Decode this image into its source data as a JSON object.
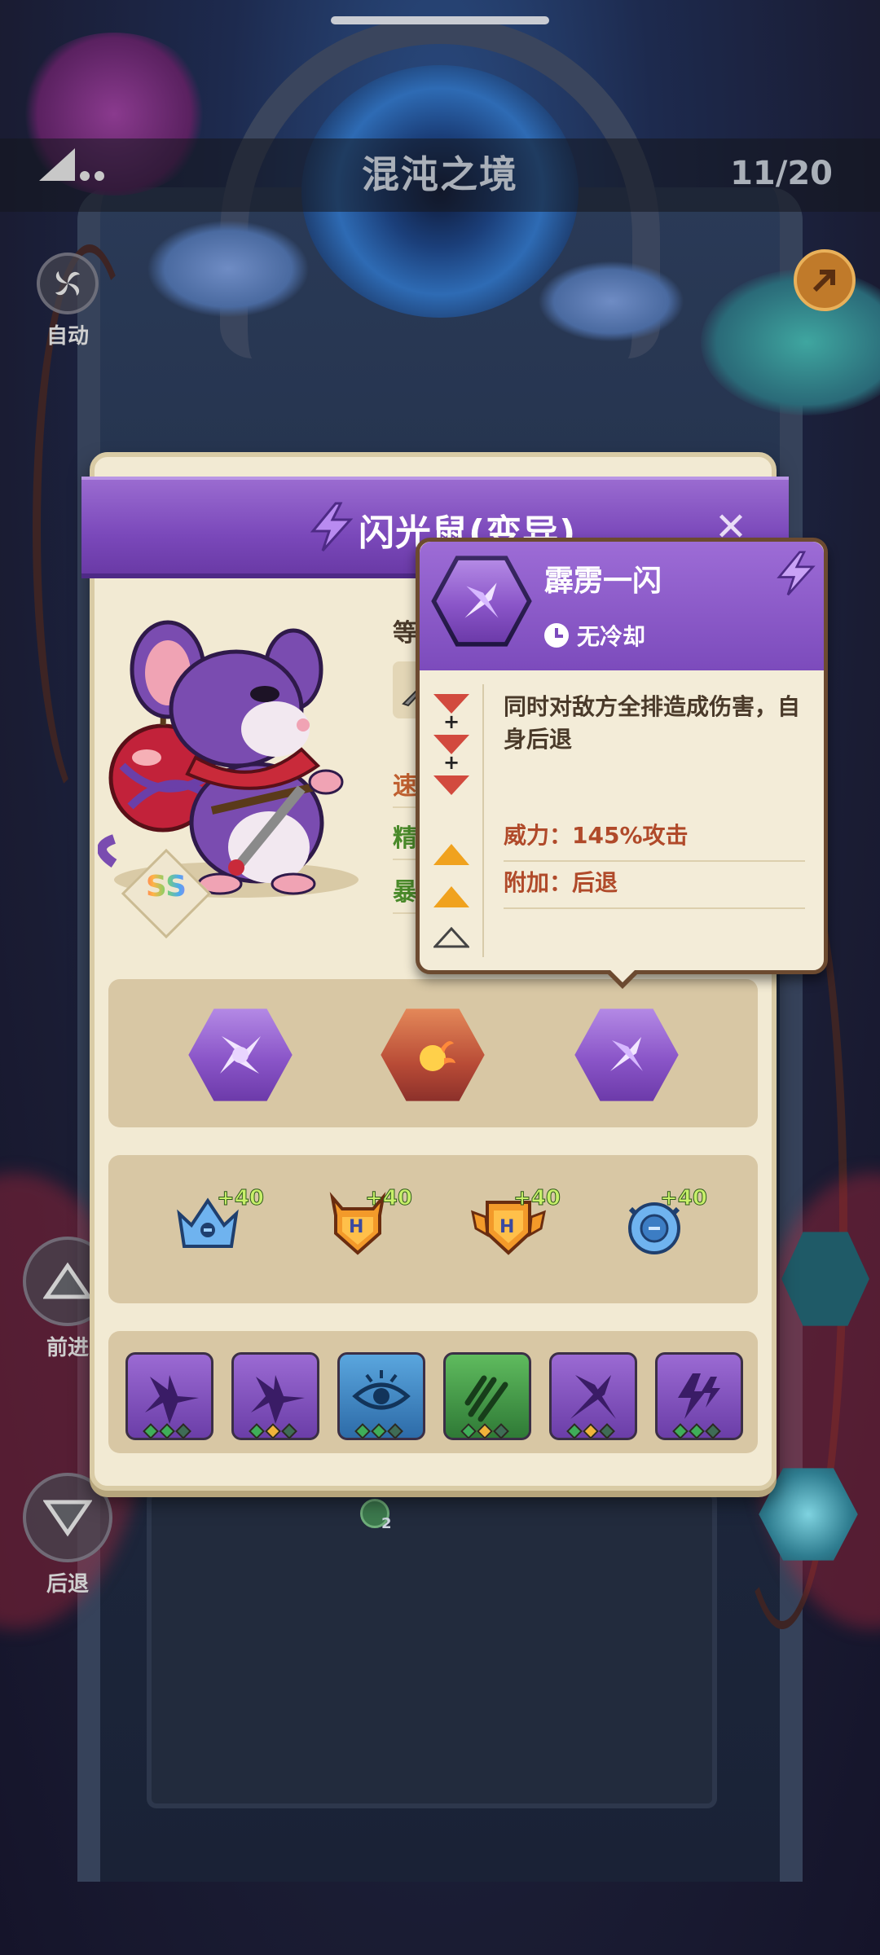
{
  "stage": {
    "title": "混沌之境",
    "progress": "11/20"
  },
  "side": {
    "auto": "自动",
    "forward": "前进",
    "back": "后退",
    "bottom_badge": "2"
  },
  "hero": {
    "name": "闪光鼠(变异)",
    "rank": "SS",
    "rank_colors": [
      "#ff5d5d",
      "#ffb347",
      "#7bd36b",
      "#4ea8f0",
      "#b874f0"
    ]
  },
  "stats_partial": {
    "level": "等",
    "speed": "速",
    "precision": "精",
    "crit": "暴"
  },
  "skills": [
    {
      "icon": "shuriken-icon",
      "color": "#8a55c8"
    },
    {
      "icon": "fireball-icon",
      "color": "#b84b36"
    },
    {
      "icon": "crossed-blades-icon",
      "color": "#8a55c8"
    }
  ],
  "equipment": [
    {
      "icon": "crown-icon",
      "bonus": "+40",
      "letter": ""
    },
    {
      "icon": "horned-badge-icon",
      "bonus": "+40",
      "letter": "H"
    },
    {
      "icon": "winged-badge-icon",
      "bonus": "+40",
      "letter": "H"
    },
    {
      "icon": "ring-icon",
      "bonus": "+40",
      "letter": ""
    }
  ],
  "passives": [
    {
      "icon": "shuriken-burst-icon",
      "style": "purple",
      "pips": [
        "#3fae59",
        "#3fae59",
        "#3f6c56"
      ]
    },
    {
      "icon": "shuriken-burst-icon",
      "style": "purple",
      "pips": [
        "#3fae59",
        "#f0b43a",
        "#3f6c56"
      ]
    },
    {
      "icon": "eye-icon",
      "style": "blue",
      "pips": [
        "#3fae59",
        "#3fae59",
        "#3f6c56"
      ]
    },
    {
      "icon": "claw-icon",
      "style": "green",
      "pips": [
        "#3fae59",
        "#f0b43a",
        "#3f6c56"
      ]
    },
    {
      "icon": "crossed-blades-icon",
      "style": "purple",
      "pips": [
        "#3fae59",
        "#f0b43a",
        "#3f6c56"
      ]
    },
    {
      "icon": "lightning-icon",
      "style": "purple",
      "pips": [
        "#3fae59",
        "#3fae59",
        "#3f6c56"
      ]
    }
  ],
  "tooltip": {
    "name": "霹雳一闪",
    "cooldown": "无冷却",
    "description": "同时对敌方全排造成伤害，自身后退",
    "power": "威力：145%攻击",
    "extra": "附加：后退",
    "colors": {
      "header": "#7c4bbc",
      "stat_text": "#b04a2a"
    }
  }
}
